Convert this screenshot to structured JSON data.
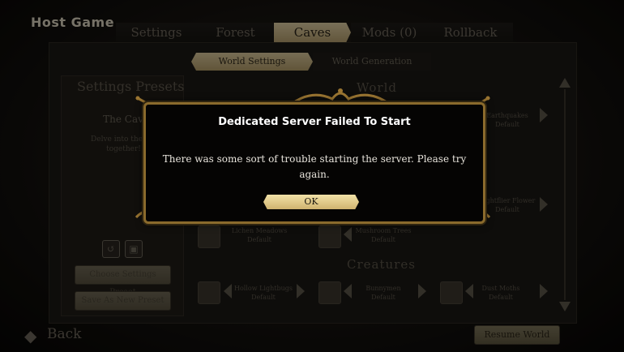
{
  "header": {
    "title": "Host Game"
  },
  "main_tabs": [
    {
      "label": "Settings",
      "active": false
    },
    {
      "label": "Forest",
      "active": false
    },
    {
      "label": "Caves",
      "active": true
    },
    {
      "label": "Mods (0)",
      "active": false
    },
    {
      "label": "Rollback",
      "active": false
    }
  ],
  "sub_tabs": [
    {
      "label": "World Settings",
      "active": true
    },
    {
      "label": "World Generation",
      "active": false
    }
  ],
  "presets": {
    "title": "Settings Presets",
    "preset_name": "The Cav",
    "preset_desc": "Delve into the c… together!",
    "choose_label": "Choose Settings Preset",
    "save_label": "Save As New Preset",
    "revert_icon": "revert-icon",
    "save_icon": "save-disk-icon"
  },
  "world": {
    "section_world": "World",
    "section_creatures": "Creatures",
    "rows": [
      {
        "name": "Earthquakes",
        "value": "Default"
      },
      {
        "name": "Lightflier Flower",
        "value": "Default"
      },
      {
        "name": "Lichen Meadows",
        "value": "Default"
      },
      {
        "name": "Mushroom Trees",
        "value": "Default"
      },
      {
        "name": "Hollow Lightbugs",
        "value": "Default"
      },
      {
        "name": "Bunnymen",
        "value": "Default"
      },
      {
        "name": "Dust Moths",
        "value": "Default"
      }
    ]
  },
  "footer": {
    "back_label": "Back",
    "resume_label": "Resume World"
  },
  "dialog": {
    "title": "Dedicated Server Failed To Start",
    "body": "There was some sort of trouble starting the server. Please try again.",
    "ok_label": "OK"
  },
  "colors": {
    "accent_gold": "#cfb36f",
    "frame": "#8a6a2c",
    "dialog_bg": "#050403"
  }
}
